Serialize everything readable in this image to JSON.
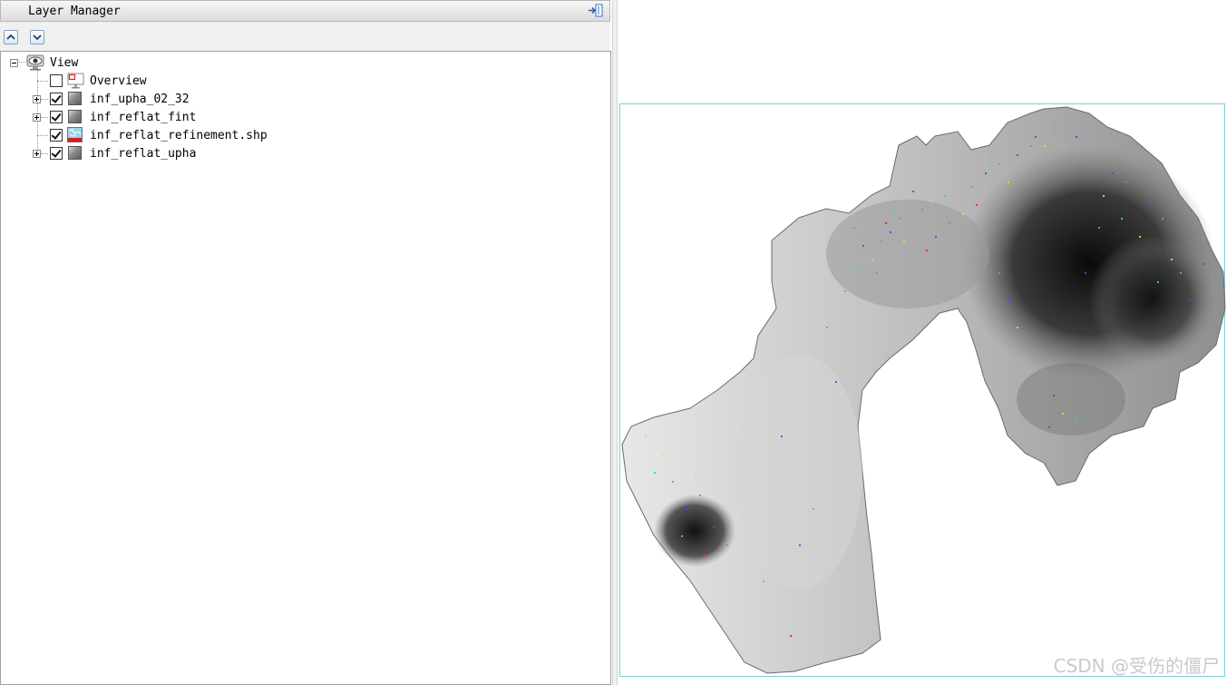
{
  "panel": {
    "title": "Layer Manager"
  },
  "toolbar": {
    "move_up_icon": "arrow-up-icon",
    "move_down_icon": "arrow-down-icon"
  },
  "tree": {
    "root": {
      "label": "View",
      "icon": "eye-icon",
      "expanded": true
    },
    "layers": [
      {
        "label": "Overview",
        "checked": false,
        "icon": "overview-icon",
        "expandable": false
      },
      {
        "label": "inf_upha_02_32",
        "checked": true,
        "icon": "raster-icon",
        "expandable": true
      },
      {
        "label": "inf_reflat_fint",
        "checked": true,
        "icon": "raster-icon",
        "expandable": true
      },
      {
        "label": "inf_reflat_refinement.shp",
        "checked": true,
        "icon": "vector-icon",
        "expandable": false
      },
      {
        "label": "inf_reflat_upha",
        "checked": true,
        "icon": "raster-icon",
        "expandable": true
      }
    ]
  },
  "map": {
    "frame_color": "#7fd0d4",
    "watermark": "CSDN @受伤的僵尸"
  }
}
